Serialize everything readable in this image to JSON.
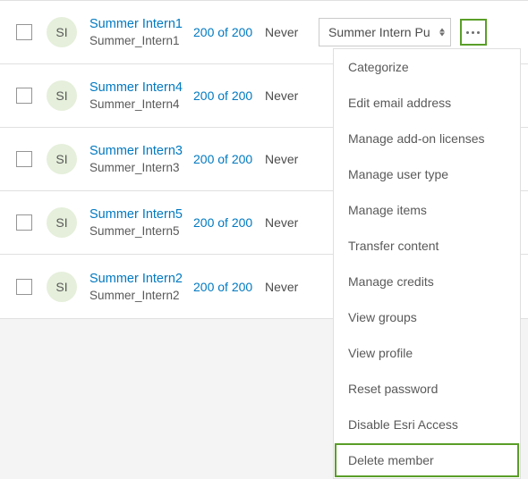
{
  "rows": [
    {
      "initials": "SI",
      "display": "Summer Intern1",
      "user": "Summer_Intern1",
      "quota": "200 of 200",
      "last": "Never",
      "role": "Summer Intern Pu",
      "more_highlight": true
    },
    {
      "initials": "SI",
      "display": "Summer Intern4",
      "user": "Summer_Intern4",
      "quota": "200 of 200",
      "last": "Never",
      "role": "",
      "more_highlight": false
    },
    {
      "initials": "SI",
      "display": "Summer Intern3",
      "user": "Summer_Intern3",
      "quota": "200 of 200",
      "last": "Never",
      "role": "",
      "more_highlight": false
    },
    {
      "initials": "SI",
      "display": "Summer Intern5",
      "user": "Summer_Intern5",
      "quota": "200 of 200",
      "last": "Never",
      "role": "",
      "more_highlight": false
    },
    {
      "initials": "SI",
      "display": "Summer Intern2",
      "user": "Summer_Intern2",
      "quota": "200 of 200",
      "last": "Never",
      "role": "",
      "more_highlight": false
    }
  ],
  "menu": {
    "items": [
      "Categorize",
      "Edit email address",
      "Manage add-on licenses",
      "Manage user type",
      "Manage items",
      "Transfer content",
      "Manage credits",
      "View groups",
      "View profile",
      "Reset password",
      "Disable Esri Access",
      "Delete member"
    ],
    "highlight_index": 11
  }
}
